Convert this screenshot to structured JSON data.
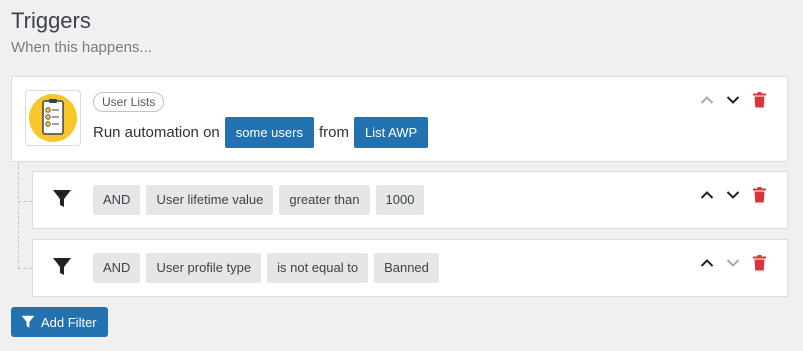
{
  "header": {
    "title": "Triggers",
    "subtitle": "When this happens..."
  },
  "trigger": {
    "badge": "User Lists",
    "text_prefix": "Run automation on",
    "target_label": "some users",
    "text_mid": "from",
    "list_label": "List AWP",
    "icon": "clipboard-list-icon"
  },
  "filters": [
    {
      "conjunction": "AND",
      "field": "User lifetime value",
      "operator": "greater than",
      "value": "1000"
    },
    {
      "conjunction": "AND",
      "field": "User profile type",
      "operator": "is not equal to",
      "value": "Banned"
    }
  ],
  "add_filter_label": "Add Filter",
  "colors": {
    "accent": "#2271b1",
    "danger": "#d63638",
    "icon_yellow": "#f7c628"
  }
}
